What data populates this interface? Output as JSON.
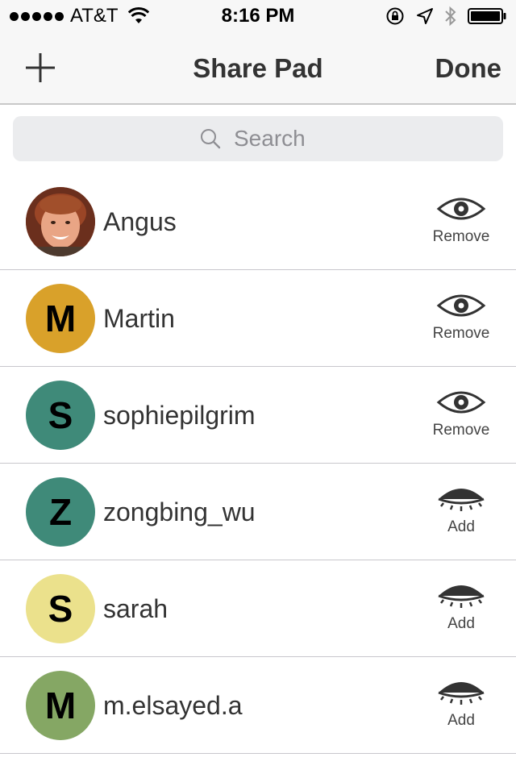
{
  "status_bar": {
    "carrier": "AT&T",
    "time": "8:16 PM"
  },
  "nav": {
    "title": "Share Pad",
    "done_label": "Done",
    "add_icon": "plus-icon"
  },
  "search": {
    "placeholder": "Search"
  },
  "colors": {
    "amber": "#d9a12a",
    "teal": "#3f8a79",
    "pale_yellow": "#ebe18c",
    "olive_green": "#85a764"
  },
  "users": [
    {
      "name": "Angus",
      "avatar_type": "photo",
      "avatar_letter": "",
      "avatar_color": "",
      "action": "Remove",
      "icon": "eye-open-icon"
    },
    {
      "name": "Martin",
      "avatar_type": "letter",
      "avatar_letter": "M",
      "avatar_color": "#d9a12a",
      "action": "Remove",
      "icon": "eye-open-icon"
    },
    {
      "name": "sophiepilgrim",
      "avatar_type": "letter",
      "avatar_letter": "S",
      "avatar_color": "#3f8a79",
      "action": "Remove",
      "icon": "eye-open-icon"
    },
    {
      "name": "zongbing_wu",
      "avatar_type": "letter",
      "avatar_letter": "Z",
      "avatar_color": "#3f8a79",
      "action": "Add",
      "icon": "eye-closed-icon"
    },
    {
      "name": "sarah",
      "avatar_type": "letter",
      "avatar_letter": "S",
      "avatar_color": "#ebe18c",
      "action": "Add",
      "icon": "eye-closed-icon"
    },
    {
      "name": "m.elsayed.a",
      "avatar_type": "letter",
      "avatar_letter": "M",
      "avatar_color": "#85a764",
      "action": "Add",
      "icon": "eye-closed-icon"
    }
  ]
}
